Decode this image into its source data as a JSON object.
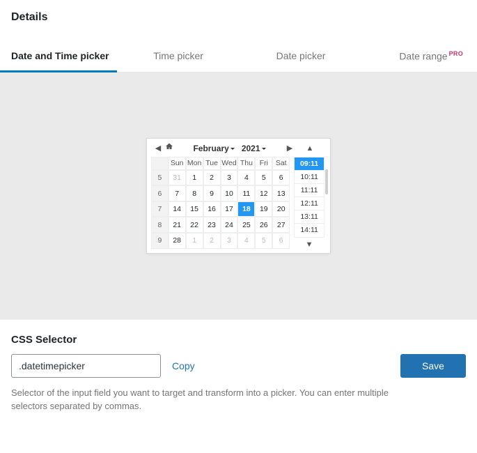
{
  "header": {
    "title": "Details"
  },
  "tabs": [
    {
      "label": "Date and Time picker",
      "active": true
    },
    {
      "label": "Time picker",
      "active": false
    },
    {
      "label": "Date picker",
      "active": false
    },
    {
      "label": "Date range",
      "active": false,
      "badge": "PRO"
    }
  ],
  "picker": {
    "month": "February",
    "year": "2021",
    "weekdays": [
      "Sun",
      "Mon",
      "Tue",
      "Wed",
      "Thu",
      "Fri",
      "Sat"
    ],
    "rows": [
      {
        "week": "5",
        "days": [
          {
            "n": "31",
            "other": true
          },
          {
            "n": "1"
          },
          {
            "n": "2"
          },
          {
            "n": "3"
          },
          {
            "n": "4"
          },
          {
            "n": "5"
          },
          {
            "n": "6"
          }
        ]
      },
      {
        "week": "6",
        "days": [
          {
            "n": "7"
          },
          {
            "n": "8"
          },
          {
            "n": "9"
          },
          {
            "n": "10"
          },
          {
            "n": "11"
          },
          {
            "n": "12"
          },
          {
            "n": "13"
          }
        ]
      },
      {
        "week": "7",
        "days": [
          {
            "n": "14"
          },
          {
            "n": "15"
          },
          {
            "n": "16"
          },
          {
            "n": "17"
          },
          {
            "n": "18",
            "selected": true
          },
          {
            "n": "19"
          },
          {
            "n": "20"
          }
        ]
      },
      {
        "week": "8",
        "days": [
          {
            "n": "21"
          },
          {
            "n": "22"
          },
          {
            "n": "23"
          },
          {
            "n": "24"
          },
          {
            "n": "25"
          },
          {
            "n": "26"
          },
          {
            "n": "27"
          }
        ]
      },
      {
        "week": "9",
        "days": [
          {
            "n": "28"
          },
          {
            "n": "1",
            "other": true
          },
          {
            "n": "2",
            "other": true
          },
          {
            "n": "3",
            "other": true
          },
          {
            "n": "4",
            "other": true
          },
          {
            "n": "5",
            "other": true
          },
          {
            "n": "6",
            "other": true
          }
        ]
      }
    ],
    "times": [
      "09:11",
      "10:11",
      "11:11",
      "12:11",
      "13:11",
      "14:11"
    ],
    "time_selected_index": 0
  },
  "selector": {
    "label": "CSS Selector",
    "value": ".datetimepicker",
    "copy_label": "Copy",
    "help": "Selector of the input field you want to target and transform into a picker. You can enter multiple selectors separated by commas."
  },
  "actions": {
    "save": "Save"
  }
}
